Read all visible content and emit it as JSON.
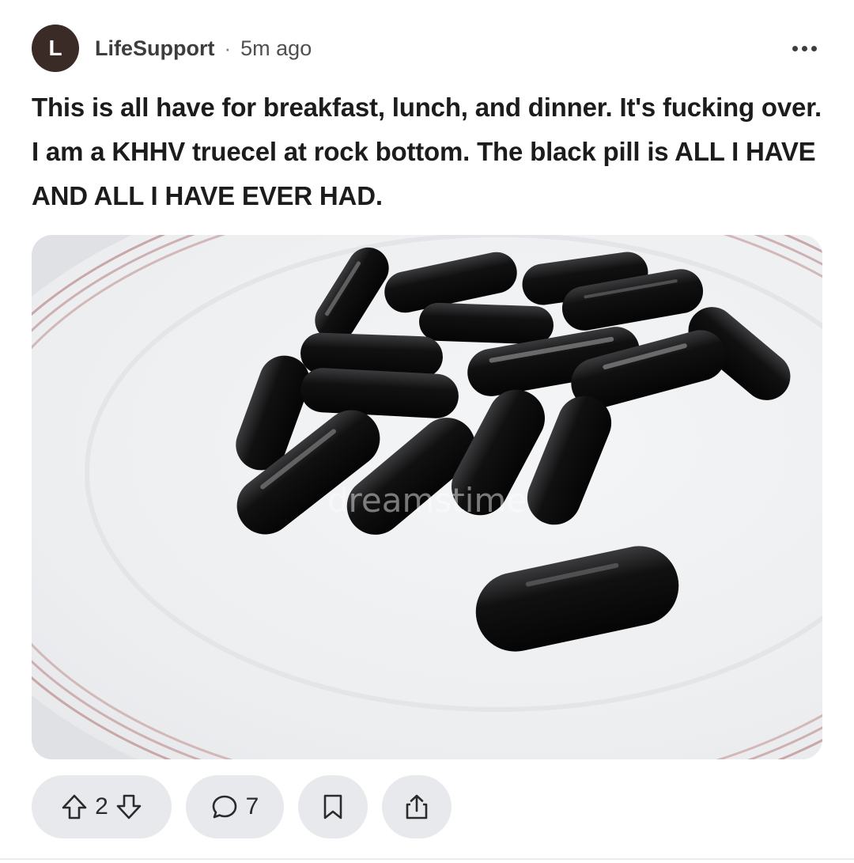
{
  "post": {
    "author_initial": "L",
    "author": "LifeSupport",
    "separator": "·",
    "time": "5m ago",
    "body": "This is all have for breakfast, lunch, and dinner. It's fucking over. I am a KHHV truecel at rock bottom. The black pill is ALL I HAVE AND ALL I HAVE EVER HAD.",
    "image": {
      "watermark": "dreamstime"
    }
  },
  "actions": {
    "upvotes": "2",
    "comments": "7"
  },
  "icons": {
    "more": "more-options-icon",
    "upvote": "upvote-arrow-icon",
    "downvote": "downvote-arrow-icon",
    "comment": "comment-bubble-icon",
    "save": "bookmark-icon",
    "share": "share-icon"
  },
  "colors": {
    "avatar_bg": "#3a2b27",
    "pill_bg": "#e8e9ec"
  }
}
